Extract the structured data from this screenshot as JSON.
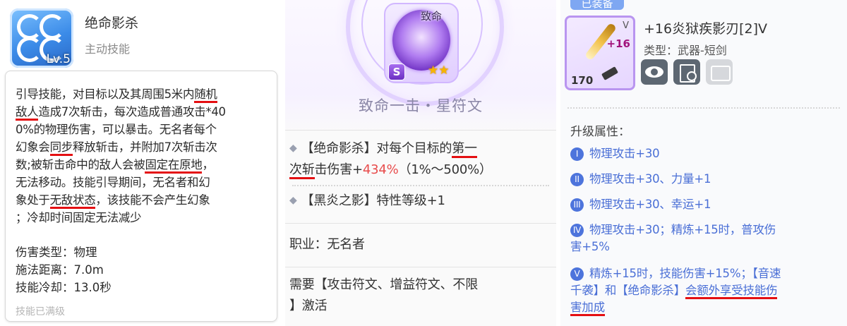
{
  "skill": {
    "name": "绝命影杀",
    "type": "主动技能",
    "level": "Lv.5",
    "description_lines": [
      [
        "引导技能，对目标以及其周围5米内",
        {
          "u": "随机"
        }
      ],
      [
        {
          "u": "敌人"
        },
        "造成7次斩击，每次造成普通攻击*40"
      ],
      [
        "0%的物理伤害，可以暴击。无名者每个"
      ],
      [
        "幻象会",
        {
          "u": "同步"
        },
        "释放斩击，并附加7次斩击次"
      ],
      [
        "数;被斩击命中的敌人会被",
        {
          "u": "固定在原地"
        },
        "，"
      ],
      [
        "无法移动。技能引导期间，无名者和幻"
      ],
      [
        "象处于",
        {
          "u": "无敌状态"
        },
        "，该技能不会产生幻象"
      ],
      [
        "；冷却时间固定无法减少"
      ]
    ],
    "stats": [
      "伤害类型：物理",
      "施法距离：7.0m",
      "技能冷却：13.0秒"
    ],
    "footer_faded": "技能已满级"
  },
  "rune": {
    "badge": "致命",
    "grade": "S",
    "stars": "★★",
    "title": "致命一击・星符文",
    "effect1_lines": [
      [
        "【绝命影杀】对每个目标的",
        {
          "u": "第一"
        }
      ],
      [
        {
          "u": "次斩"
        },
        "击伤害+",
        {
          "r": "434%"
        },
        "（1%～500%）"
      ]
    ],
    "effect2": "【黑炎之影】特性等级+1",
    "profession": "职业：无名者",
    "requirement_lines": [
      "需要【攻击符文、增益符文、不限",
      "】激活"
    ]
  },
  "weapon": {
    "equipped_tab": "已装备",
    "name": "+16炎狱疾影刃[2]V",
    "type": "类型：武器-短剑",
    "plus": "+16",
    "rank": "V",
    "level": "170",
    "upgrade_label": "升级属性：",
    "upgrades": [
      {
        "num": "I",
        "lines": [
          [
            "物理攻击+30"
          ]
        ]
      },
      {
        "num": "II",
        "lines": [
          [
            "物理攻击+30、力量+1"
          ]
        ]
      },
      {
        "num": "III",
        "lines": [
          [
            "物理攻击+30、幸运+1"
          ]
        ]
      },
      {
        "num": "IV",
        "lines": [
          [
            "物理攻击+30；精炼+15时，普攻伤"
          ],
          [
            "害+5%"
          ]
        ]
      },
      {
        "num": "V",
        "lines": [
          [
            "精炼+15时，技能伤害+15%；【音速"
          ],
          [
            "千袭】和【绝命影杀】",
            {
              "u": "会额外享受技能伤"
            }
          ],
          [
            {
              "u": "害加成"
            }
          ]
        ]
      }
    ]
  },
  "colors": {
    "underline": "#e40f12",
    "highlight": "#e84c4c",
    "upgrade_text": "#4a6fd6"
  }
}
